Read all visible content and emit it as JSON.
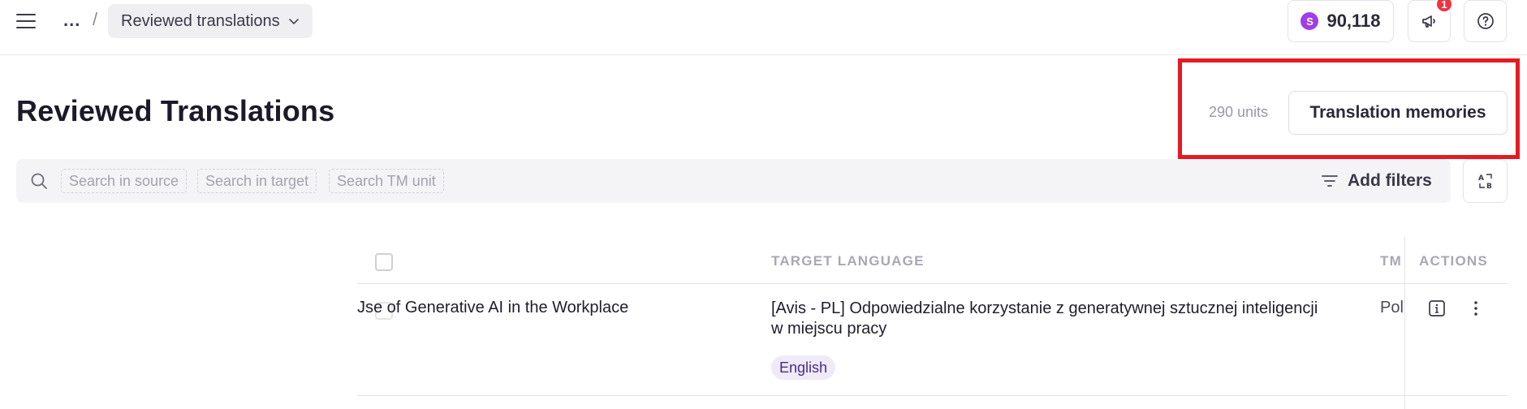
{
  "breadcrumb": {
    "ellipsis": "...",
    "separator": "/",
    "current": "Reviewed translations"
  },
  "header": {
    "credits": {
      "icon_letter": "S",
      "amount": "90,118"
    },
    "notifications": {
      "count": "1"
    }
  },
  "page": {
    "title": "Reviewed Translations",
    "units": "290 units",
    "tm_button": "Translation memories"
  },
  "search": {
    "chips": [
      "Search in source",
      "Search in target",
      "Search TM unit"
    ],
    "add_filters": "Add filters"
  },
  "table": {
    "columns": {
      "target_language": "TARGET LANGUAGE",
      "tm": "TM",
      "actions": "ACTIONS"
    },
    "rows": [
      {
        "source": "Jse of Generative AI in the Workplace",
        "target": "[Avis - PL] Odpowiedzialne korzystanie z generatywnej sztucznej inteligencji w miejscu pracy",
        "language": "English",
        "tm": "Pol"
      }
    ]
  },
  "colors": {
    "accent_purple": "#a03ee6",
    "notification_red": "#ef3340",
    "highlight_red": "#e31b23",
    "language_badge_bg": "#efeaf8"
  },
  "icons": [
    "menu-icon",
    "chevron-down-icon",
    "megaphone-icon",
    "help-icon",
    "search-icon",
    "filter-icon",
    "translate-icon",
    "info-icon",
    "more-vertical-icon"
  ]
}
